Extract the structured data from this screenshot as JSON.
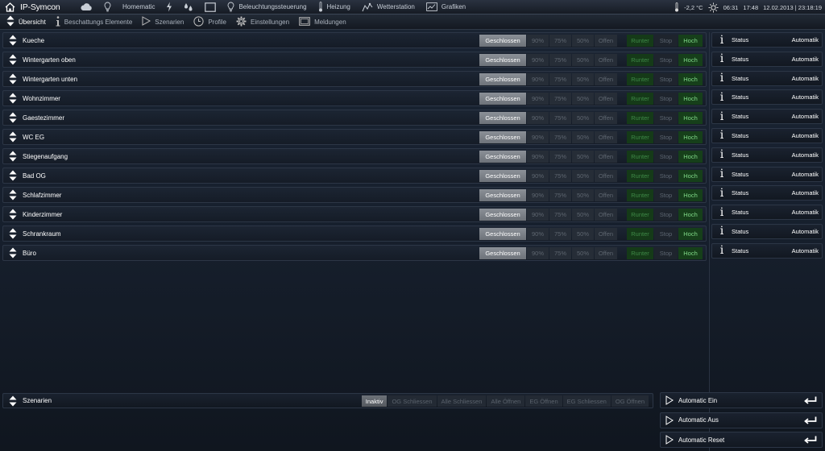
{
  "app": {
    "title": "IP-Symcon"
  },
  "topnav": [
    {
      "icon": "cloud-icon",
      "label": ""
    },
    {
      "icon": "lightbulb-icon",
      "label": ""
    },
    {
      "icon": "",
      "label": "Homematic"
    },
    {
      "icon": "lightning-icon",
      "label": ""
    },
    {
      "icon": "water-drops-icon",
      "label": ""
    },
    {
      "icon": "window-frame-icon",
      "label": ""
    },
    {
      "icon": "lightbulb-icon",
      "label": "Beleuchtungssteuerung"
    },
    {
      "icon": "thermometer-icon",
      "label": "Heizung"
    },
    {
      "icon": "weather-icon",
      "label": "Wetterstation"
    },
    {
      "icon": "chart-icon",
      "label": "Grafiken"
    }
  ],
  "topbar_status": {
    "temperature": "-2,2 °C",
    "sunrise": "06:31",
    "sunset": "17:48",
    "datetime": "12.02.2013 | 23:18:19"
  },
  "subnav": [
    {
      "icon": "updown-arrows-icon",
      "label": "Übersicht",
      "active": true
    },
    {
      "icon": "info-icon",
      "label": "Beschattungs Elemente",
      "active": false
    },
    {
      "icon": "play-icon",
      "label": "Szenarien",
      "active": false
    },
    {
      "icon": "clock-icon",
      "label": "Profile",
      "active": false
    },
    {
      "icon": "gear-icon",
      "label": "Einstellungen",
      "active": false
    },
    {
      "icon": "message-icon",
      "label": "Meldungen",
      "active": false
    }
  ],
  "shutter_buttons": {
    "closed": "Geschlossen",
    "p90": "90%",
    "p75": "75%",
    "p50": "50%",
    "open": "Offen",
    "down": "Runter",
    "stop": "Stop",
    "up": "Hoch"
  },
  "rooms": [
    "Kueche",
    "Wintergarten oben",
    "Wintergarten unten",
    "Wohnzimmer",
    "Gaestezimmer",
    "WC EG",
    "Stiegenaufgang",
    "Bad OG",
    "Schlafzimmer",
    "Kinderzimmer",
    "Schrankraum",
    "Büro"
  ],
  "status_panel": {
    "label": "Status",
    "value": "Automatik",
    "count": 12
  },
  "scenes": {
    "label": "Szenarien",
    "buttons": [
      "Inaktiv",
      "OG Schliessen",
      "Alle Schliessen",
      "Alle Öffnen",
      "EG Öffnen",
      "EG Schliessen",
      "OG Öffnen"
    ],
    "active_index": 0
  },
  "automatic": [
    {
      "label": "Automatic Ein"
    },
    {
      "label": "Automatic Aus"
    },
    {
      "label": "Automatic Reset"
    }
  ],
  "colors": {
    "background": "#17202e",
    "active_button": "#7a7f86",
    "green_active": "#7fd887",
    "green_dim": "#3f8a47"
  }
}
